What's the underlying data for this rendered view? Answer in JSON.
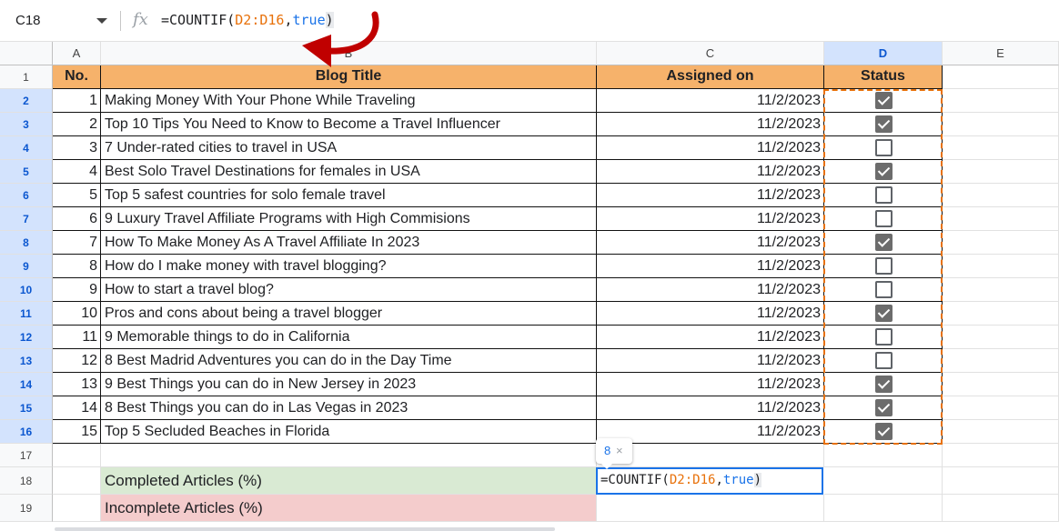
{
  "formula_bar": {
    "cell_ref": "C18",
    "fx_symbol": "fx",
    "formula_prefix": "=COUNTIF(",
    "formula_range": "D2:D16",
    "formula_comma": ",",
    "formula_keyword": "true",
    "formula_close": ")"
  },
  "columns": [
    "A",
    "B",
    "C",
    "D",
    "E"
  ],
  "rows": [
    "1",
    "2",
    "3",
    "4",
    "5",
    "6",
    "7",
    "8",
    "9",
    "10",
    "11",
    "12",
    "13",
    "14",
    "15",
    "16",
    "17",
    "18",
    "19"
  ],
  "header": {
    "no": "No.",
    "title": "Blog Title",
    "assigned": "Assigned on",
    "status": "Status"
  },
  "records": [
    {
      "no": "1",
      "title": "Making Money With Your Phone While Traveling",
      "date": "11/2/2023",
      "done": true
    },
    {
      "no": "2",
      "title": "Top 10 Tips You Need to Know to Become a Travel Influencer",
      "date": "11/2/2023",
      "done": true
    },
    {
      "no": "3",
      "title": "7 Under-rated cities to travel in USA",
      "date": "11/2/2023",
      "done": false
    },
    {
      "no": "4",
      "title": "Best Solo Travel Destinations for females in USA",
      "date": "11/2/2023",
      "done": true
    },
    {
      "no": "5",
      "title": "Top 5 safest countries for solo female travel",
      "date": "11/2/2023",
      "done": false
    },
    {
      "no": "6",
      "title": "9 Luxury Travel Affiliate Programs with High Commisions",
      "date": "11/2/2023",
      "done": false
    },
    {
      "no": "7",
      "title": "How To Make Money As A Travel Affiliate In 2023",
      "date": "11/2/2023",
      "done": true
    },
    {
      "no": "8",
      "title": "How do I make money with travel blogging?",
      "date": "11/2/2023",
      "done": false
    },
    {
      "no": "9",
      "title": "How to start a travel blog?",
      "date": "11/2/2023",
      "done": false
    },
    {
      "no": "10",
      "title": "Pros and cons about being a travel blogger",
      "date": "11/2/2023",
      "done": true
    },
    {
      "no": "11",
      "title": "9 Memorable things to do in California",
      "date": "11/2/2023",
      "done": false
    },
    {
      "no": "12",
      "title": "8 Best Madrid Adventures you can do in the Day Time",
      "date": "11/2/2023",
      "done": false
    },
    {
      "no": "13",
      "title": "9 Best Things you can do in New Jersey in 2023",
      "date": "11/2/2023",
      "done": true
    },
    {
      "no": "14",
      "title": "8 Best Things you can do in Las Vegas in 2023",
      "date": "11/2/2023",
      "done": true
    },
    {
      "no": "15",
      "title": "Top 5 Secluded Beaches in Florida",
      "date": "11/2/2023",
      "done": true
    }
  ],
  "summary": {
    "completed_label": "Completed Articles (%)",
    "incomplete_label": "Incomplete Articles (%)"
  },
  "editor": {
    "prefix": "=COUNTIF(",
    "range": "D2:D16",
    "comma": ",",
    "keyword": "true",
    "close": ")"
  },
  "tooltip": {
    "value": "8",
    "close": "×"
  },
  "colors": {
    "header_fill": "#f6b26b",
    "green_fill": "#d9ead3",
    "red_fill": "#f4cccc",
    "selection": "#d3e3fd",
    "arrow": "#c00000"
  }
}
